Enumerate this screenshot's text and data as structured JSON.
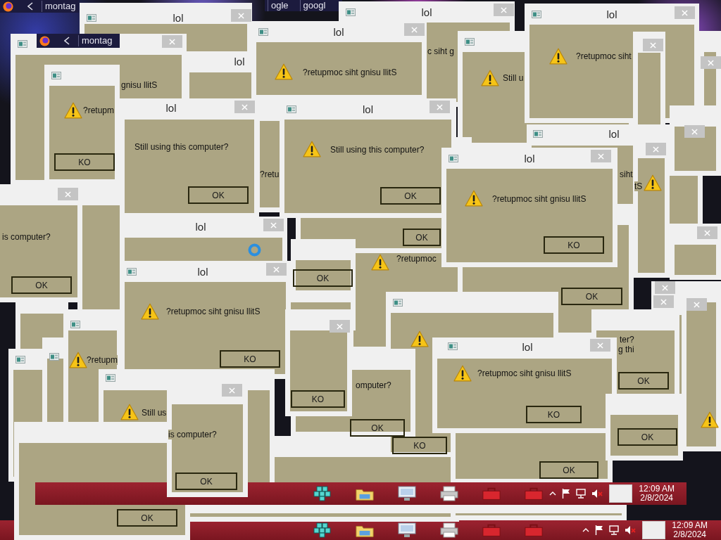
{
  "desktop": {
    "items": [
      {
        "kind": "browser_bar",
        "logo": true,
        "back": true,
        "tabs": [
          "montag"
        ]
      },
      {
        "kind": "window",
        "title": "lol",
        "app_icon": true,
        "close": true
      },
      {
        "kind": "browser_bar",
        "tabs": [
          "ogle",
          "googl"
        ]
      },
      {
        "kind": "window",
        "title": "lol",
        "app_icon": true,
        "close": true,
        "message": "c siht g"
      },
      {
        "kind": "window",
        "title": "lol",
        "app_icon": true,
        "close": true,
        "warning": true,
        "message": "?retupmoc siht"
      },
      {
        "kind": "window",
        "title": "lol",
        "app_icon": true,
        "close": true,
        "warning": true,
        "message": "?retupmoc siht gnisu llitS"
      },
      {
        "kind": "window",
        "app_icon": true,
        "close": true,
        "message": "gnisu llitS"
      },
      {
        "kind": "browser_bar",
        "logo": true,
        "back": true,
        "tabs": [
          "montag"
        ]
      },
      {
        "kind": "window",
        "app_icon": true,
        "warning": true,
        "message": "Still u"
      },
      {
        "kind": "window",
        "close": true
      },
      {
        "kind": "window",
        "close": true
      },
      {
        "kind": "window",
        "title": "lol"
      },
      {
        "kind": "window",
        "app_icon": true,
        "warning": true,
        "message": "?retupm",
        "button": "KO"
      },
      {
        "kind": "window",
        "title": "lol",
        "close": true,
        "message": "Still using this computer?",
        "button": "OK"
      },
      {
        "kind": "window",
        "message": "?retu"
      },
      {
        "kind": "window",
        "title": "lol",
        "app_icon": true,
        "close": true,
        "warning": true,
        "message": "Still using this computer?",
        "button": "OK"
      },
      {
        "kind": "window",
        "close": true
      },
      {
        "kind": "window",
        "title": "lol",
        "app_icon": true,
        "message": "siht"
      },
      {
        "kind": "window",
        "button": "OK"
      },
      {
        "kind": "window",
        "close": true,
        "warning": true,
        "message": "tS"
      },
      {
        "kind": "window",
        "title": "lol",
        "app_icon": true,
        "close": true,
        "warning": true,
        "message": "?retupmoc siht gnisu llitS",
        "button": "KO"
      },
      {
        "kind": "window",
        "close": true,
        "message": "is computer?",
        "button": "OK"
      },
      {
        "kind": "window"
      },
      {
        "kind": "window",
        "warning": true,
        "message": "?retupmoc"
      },
      {
        "kind": "window",
        "button": "OK"
      },
      {
        "kind": "window",
        "title": "lol",
        "close": true
      },
      {
        "kind": "window",
        "close": true
      },
      {
        "kind": "window",
        "button": "OK"
      },
      {
        "kind": "window",
        "title": "lol",
        "app_icon": true,
        "close": true,
        "warning": true,
        "message": "?retupmoc siht gnisu llitS",
        "button": "KO"
      },
      {
        "kind": "window"
      },
      {
        "kind": "window",
        "close": true
      },
      {
        "kind": "window",
        "close": true,
        "warning": true
      },
      {
        "kind": "window"
      },
      {
        "kind": "window",
        "app_icon": true,
        "warning": true,
        "button": "KO"
      },
      {
        "kind": "window",
        "close": true
      },
      {
        "kind": "window",
        "app_icon": true,
        "warning": true,
        "message": "?retupm"
      },
      {
        "kind": "window",
        "close": true,
        "button": "KO"
      },
      {
        "kind": "window",
        "message": "ter?",
        "button": "OK"
      },
      {
        "kind": "window",
        "app_icon": true
      },
      {
        "kind": "window",
        "title": "lol",
        "app_icon": true,
        "close": true,
        "warning": true,
        "message": "?retupmoc siht gnisu llitS",
        "button": "KO"
      },
      {
        "kind": "window",
        "app_icon": true
      },
      {
        "kind": "window",
        "message": "omputer?",
        "button": "OK"
      },
      {
        "kind": "fragment",
        "text": "g thi"
      },
      {
        "kind": "window",
        "app_icon": true,
        "warning": true,
        "message": "Still us"
      },
      {
        "kind": "window",
        "close": true,
        "message": "is computer?",
        "button": "OK"
      },
      {
        "kind": "window",
        "button": "OK"
      },
      {
        "kind": "window",
        "button": "OK"
      },
      {
        "kind": "window",
        "button": "OK"
      },
      {
        "kind": "window"
      },
      {
        "kind": "taskbar",
        "time": "12:09 AM",
        "date": "2/8/2024"
      },
      {
        "kind": "window"
      },
      {
        "kind": "window"
      },
      {
        "kind": "taskbar",
        "time": "12:09 AM",
        "date": "2/8/2024"
      }
    ]
  }
}
